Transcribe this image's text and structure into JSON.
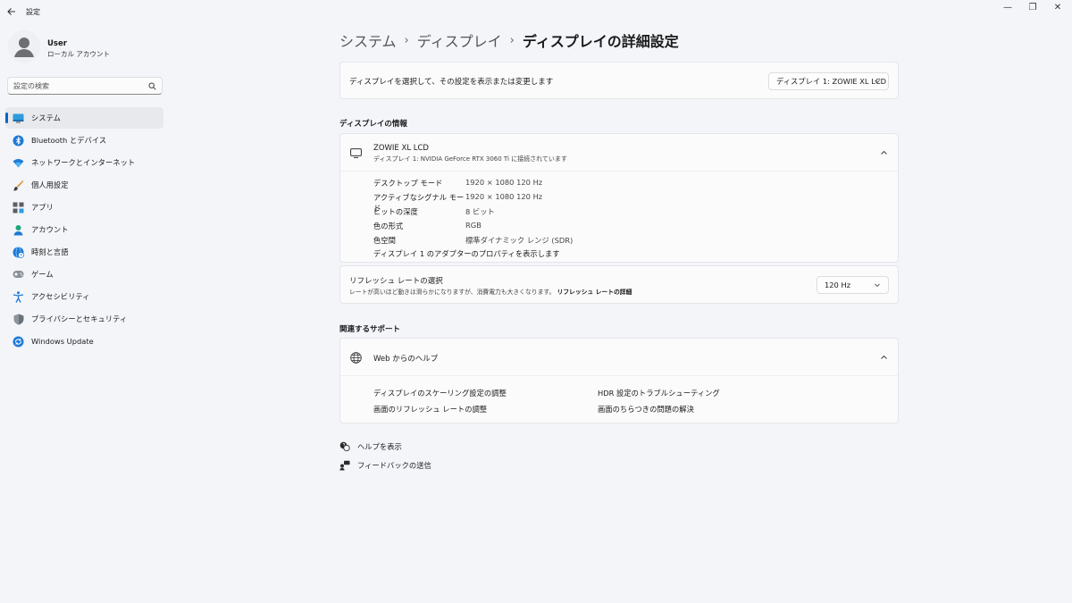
{
  "app": {
    "title": "設定"
  },
  "window": {
    "minimize": "—",
    "maximize": "❐",
    "close": "✕"
  },
  "user": {
    "name": "User",
    "account_type": "ローカル アカウント"
  },
  "search": {
    "placeholder": "設定の検索"
  },
  "sidebar": {
    "items": [
      {
        "label": "システム",
        "icon": "system-icon",
        "active": true
      },
      {
        "label": "Bluetooth とデバイス",
        "icon": "bluetooth-icon"
      },
      {
        "label": "ネットワークとインターネット",
        "icon": "wifi-icon"
      },
      {
        "label": "個人用設定",
        "icon": "brush-icon"
      },
      {
        "label": "アプリ",
        "icon": "apps-icon"
      },
      {
        "label": "アカウント",
        "icon": "account-icon"
      },
      {
        "label": "時刻と言語",
        "icon": "globe-clock-icon"
      },
      {
        "label": "ゲーム",
        "icon": "gamepad-icon"
      },
      {
        "label": "アクセシビリティ",
        "icon": "accessibility-icon"
      },
      {
        "label": "プライバシーとセキュリティ",
        "icon": "shield-icon"
      },
      {
        "label": "Windows Update",
        "icon": "update-icon"
      }
    ]
  },
  "breadcrumb": {
    "items": [
      "システム",
      "ディスプレイ"
    ],
    "current": "ディスプレイの詳細設定"
  },
  "display_select": {
    "label": "ディスプレイを選択して、その設定を表示または変更します",
    "selected": "ディスプレイ 1: ZOWIE XL LCD"
  },
  "display_info": {
    "section_title": "ディスプレイの情報",
    "name": "ZOWIE XL LCD",
    "subtitle": "ディスプレイ 1: NVIDIA GeForce RTX 3060 Ti に接続されています",
    "rows": [
      {
        "key": "デスクトップ モード",
        "value": "1920 × 1080 120 Hz"
      },
      {
        "key": "アクティブなシグナル モード",
        "value": "1920 × 1080 120 Hz"
      },
      {
        "key": "ビットの深度",
        "value": "8 ビット"
      },
      {
        "key": "色の形式",
        "value": "RGB"
      },
      {
        "key": "色空間",
        "value": "標準ダイナミック レンジ (SDR)"
      }
    ],
    "adapter_link": "ディスプレイ 1 のアダプターのプロパティを表示します"
  },
  "refresh": {
    "title": "リフレッシュ レートの選択",
    "description": "レートが高いほど動きは滑らかになりますが、消費電力も大きくなります。",
    "detail_link": "リフレッシュ レートの詳細",
    "selected": "120 Hz"
  },
  "support": {
    "section_title": "関連するサポート",
    "help_title": "Web からのヘルプ",
    "links": [
      "ディスプレイのスケーリング設定の調整",
      "HDR 設定のトラブルシューティング",
      "画面のリフレッシュ レートの調整",
      "画面のちらつきの問題の解決"
    ]
  },
  "footer": {
    "help": "ヘルプを表示",
    "feedback": "フィードバックの送信"
  },
  "colors": {
    "accent": "#0067c0",
    "background": "#f3f5f9",
    "card": "#fbfbfc"
  }
}
